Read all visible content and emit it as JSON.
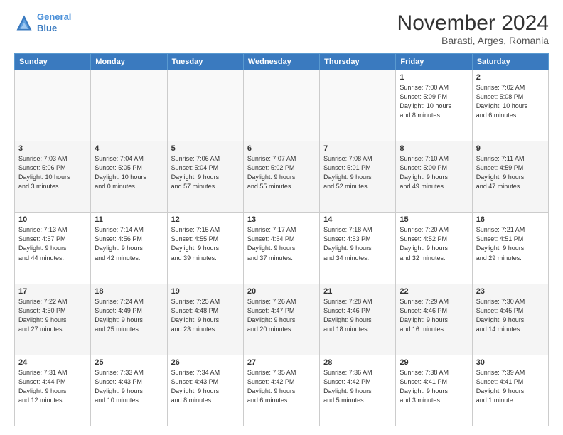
{
  "header": {
    "logo_line1": "General",
    "logo_line2": "Blue",
    "month": "November 2024",
    "location": "Barasti, Arges, Romania"
  },
  "weekdays": [
    "Sunday",
    "Monday",
    "Tuesday",
    "Wednesday",
    "Thursday",
    "Friday",
    "Saturday"
  ],
  "weeks": [
    [
      {
        "day": "",
        "info": ""
      },
      {
        "day": "",
        "info": ""
      },
      {
        "day": "",
        "info": ""
      },
      {
        "day": "",
        "info": ""
      },
      {
        "day": "",
        "info": ""
      },
      {
        "day": "1",
        "info": "Sunrise: 7:00 AM\nSunset: 5:09 PM\nDaylight: 10 hours\nand 8 minutes."
      },
      {
        "day": "2",
        "info": "Sunrise: 7:02 AM\nSunset: 5:08 PM\nDaylight: 10 hours\nand 6 minutes."
      }
    ],
    [
      {
        "day": "3",
        "info": "Sunrise: 7:03 AM\nSunset: 5:06 PM\nDaylight: 10 hours\nand 3 minutes."
      },
      {
        "day": "4",
        "info": "Sunrise: 7:04 AM\nSunset: 5:05 PM\nDaylight: 10 hours\nand 0 minutes."
      },
      {
        "day": "5",
        "info": "Sunrise: 7:06 AM\nSunset: 5:04 PM\nDaylight: 9 hours\nand 57 minutes."
      },
      {
        "day": "6",
        "info": "Sunrise: 7:07 AM\nSunset: 5:02 PM\nDaylight: 9 hours\nand 55 minutes."
      },
      {
        "day": "7",
        "info": "Sunrise: 7:08 AM\nSunset: 5:01 PM\nDaylight: 9 hours\nand 52 minutes."
      },
      {
        "day": "8",
        "info": "Sunrise: 7:10 AM\nSunset: 5:00 PM\nDaylight: 9 hours\nand 49 minutes."
      },
      {
        "day": "9",
        "info": "Sunrise: 7:11 AM\nSunset: 4:59 PM\nDaylight: 9 hours\nand 47 minutes."
      }
    ],
    [
      {
        "day": "10",
        "info": "Sunrise: 7:13 AM\nSunset: 4:57 PM\nDaylight: 9 hours\nand 44 minutes."
      },
      {
        "day": "11",
        "info": "Sunrise: 7:14 AM\nSunset: 4:56 PM\nDaylight: 9 hours\nand 42 minutes."
      },
      {
        "day": "12",
        "info": "Sunrise: 7:15 AM\nSunset: 4:55 PM\nDaylight: 9 hours\nand 39 minutes."
      },
      {
        "day": "13",
        "info": "Sunrise: 7:17 AM\nSunset: 4:54 PM\nDaylight: 9 hours\nand 37 minutes."
      },
      {
        "day": "14",
        "info": "Sunrise: 7:18 AM\nSunset: 4:53 PM\nDaylight: 9 hours\nand 34 minutes."
      },
      {
        "day": "15",
        "info": "Sunrise: 7:20 AM\nSunset: 4:52 PM\nDaylight: 9 hours\nand 32 minutes."
      },
      {
        "day": "16",
        "info": "Sunrise: 7:21 AM\nSunset: 4:51 PM\nDaylight: 9 hours\nand 29 minutes."
      }
    ],
    [
      {
        "day": "17",
        "info": "Sunrise: 7:22 AM\nSunset: 4:50 PM\nDaylight: 9 hours\nand 27 minutes."
      },
      {
        "day": "18",
        "info": "Sunrise: 7:24 AM\nSunset: 4:49 PM\nDaylight: 9 hours\nand 25 minutes."
      },
      {
        "day": "19",
        "info": "Sunrise: 7:25 AM\nSunset: 4:48 PM\nDaylight: 9 hours\nand 23 minutes."
      },
      {
        "day": "20",
        "info": "Sunrise: 7:26 AM\nSunset: 4:47 PM\nDaylight: 9 hours\nand 20 minutes."
      },
      {
        "day": "21",
        "info": "Sunrise: 7:28 AM\nSunset: 4:46 PM\nDaylight: 9 hours\nand 18 minutes."
      },
      {
        "day": "22",
        "info": "Sunrise: 7:29 AM\nSunset: 4:46 PM\nDaylight: 9 hours\nand 16 minutes."
      },
      {
        "day": "23",
        "info": "Sunrise: 7:30 AM\nSunset: 4:45 PM\nDaylight: 9 hours\nand 14 minutes."
      }
    ],
    [
      {
        "day": "24",
        "info": "Sunrise: 7:31 AM\nSunset: 4:44 PM\nDaylight: 9 hours\nand 12 minutes."
      },
      {
        "day": "25",
        "info": "Sunrise: 7:33 AM\nSunset: 4:43 PM\nDaylight: 9 hours\nand 10 minutes."
      },
      {
        "day": "26",
        "info": "Sunrise: 7:34 AM\nSunset: 4:43 PM\nDaylight: 9 hours\nand 8 minutes."
      },
      {
        "day": "27",
        "info": "Sunrise: 7:35 AM\nSunset: 4:42 PM\nDaylight: 9 hours\nand 6 minutes."
      },
      {
        "day": "28",
        "info": "Sunrise: 7:36 AM\nSunset: 4:42 PM\nDaylight: 9 hours\nand 5 minutes."
      },
      {
        "day": "29",
        "info": "Sunrise: 7:38 AM\nSunset: 4:41 PM\nDaylight: 9 hours\nand 3 minutes."
      },
      {
        "day": "30",
        "info": "Sunrise: 7:39 AM\nSunset: 4:41 PM\nDaylight: 9 hours\nand 1 minute."
      }
    ]
  ]
}
